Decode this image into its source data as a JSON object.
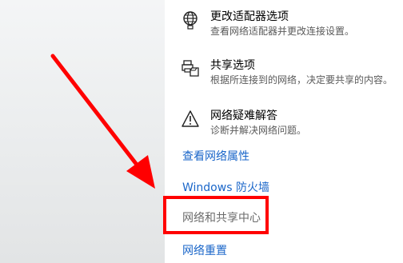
{
  "settings": {
    "items": [
      {
        "icon": "adapter-globe-icon",
        "title": "更改适配器选项",
        "desc": "查看网络适配器并更改连接设置。"
      },
      {
        "icon": "share-printer-icon",
        "title": "共享选项",
        "desc": "根据所连接到的网络，决定要共享的内容。"
      },
      {
        "icon": "warning-icon",
        "title": "网络疑难解答",
        "desc": "诊断并解决网络问题。"
      }
    ],
    "links": [
      {
        "label": "查看网络属性"
      },
      {
        "label": "Windows 防火墙"
      },
      {
        "label": "网络和共享中心"
      },
      {
        "label": "网络重置"
      }
    ]
  },
  "annotation": {
    "color": "#ff0000"
  }
}
